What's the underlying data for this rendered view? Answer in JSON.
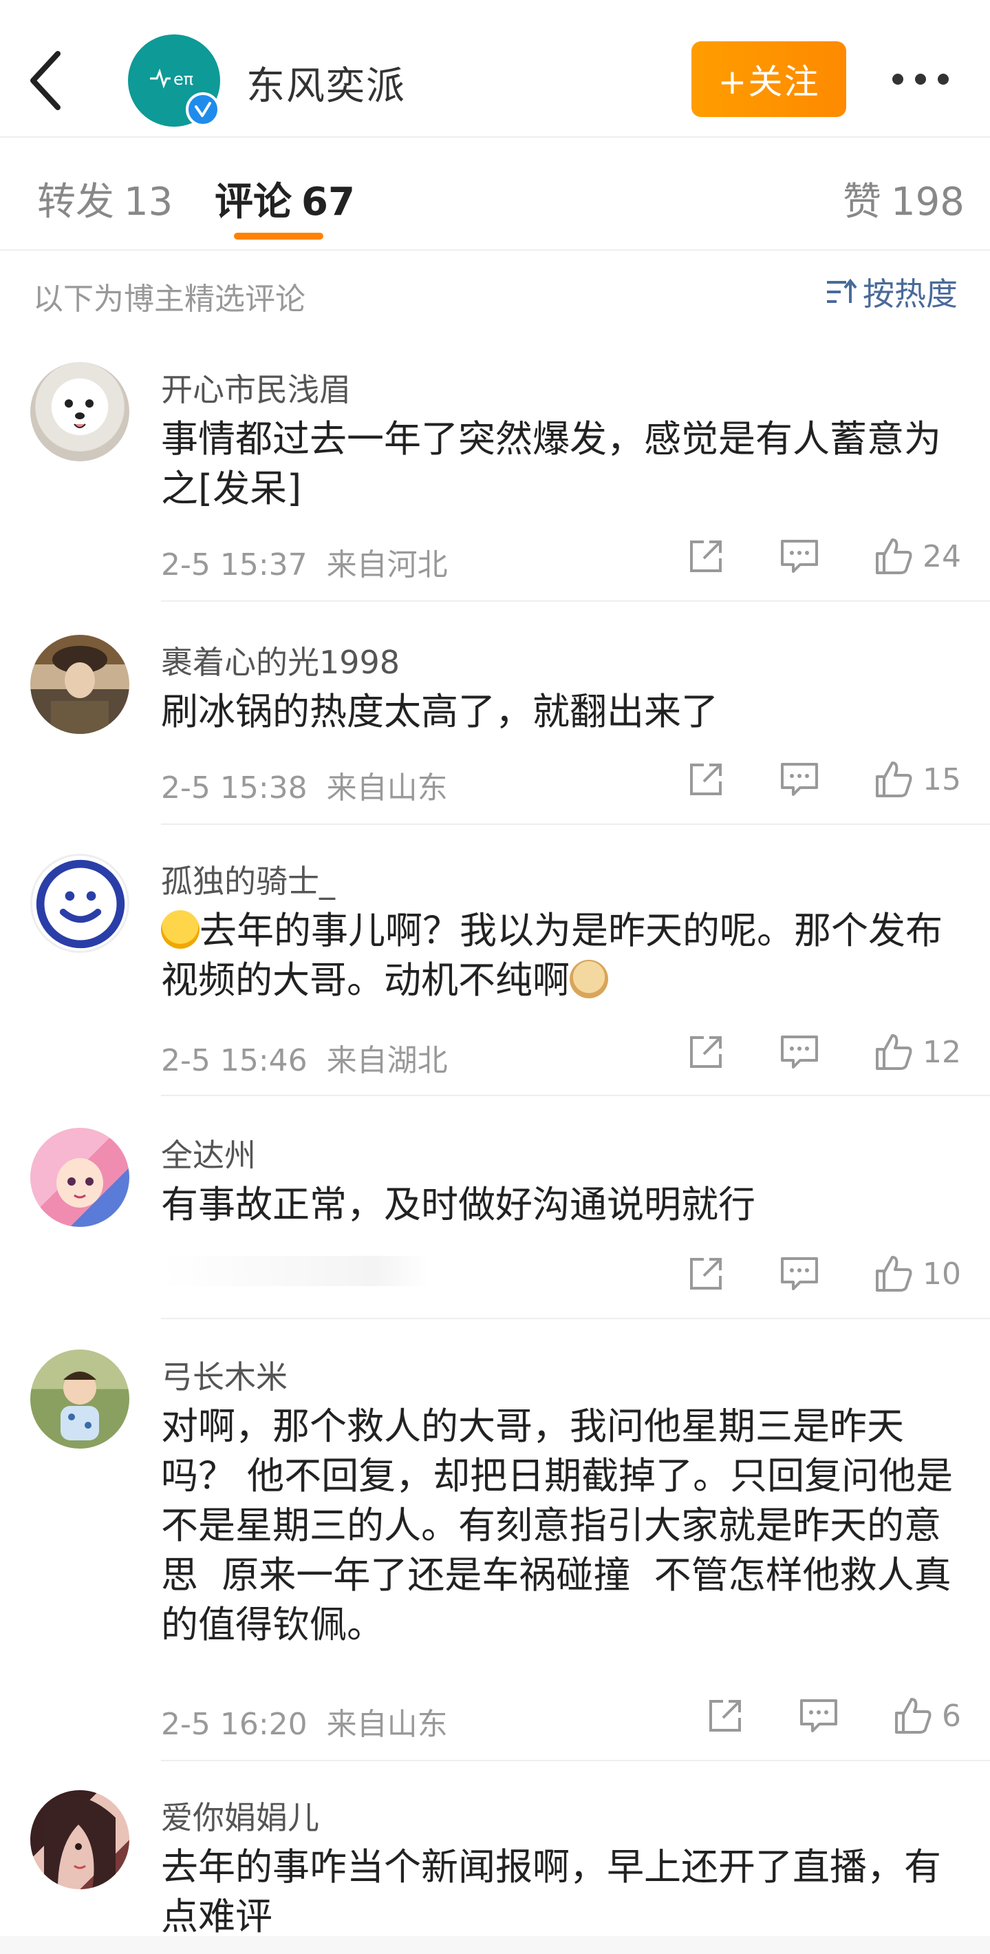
{
  "header": {
    "brand_name": "东风奕派",
    "follow_label": "+关注"
  },
  "tabs": {
    "repost": {
      "label": "转发",
      "count": "13"
    },
    "comment": {
      "label": "评论",
      "count": "67"
    },
    "like": {
      "label": "赞",
      "count": "198"
    }
  },
  "selected": {
    "label": "以下为博主精选评论",
    "sort_label": "按热度"
  },
  "comments": [
    {
      "user": "开心市民浅眉",
      "text": "事情都过去一年了突然爆发，感觉是有人蓄意为之[发呆]",
      "time": "2-5 15:37",
      "location": "来自河北",
      "likes": "24"
    },
    {
      "user": "裹着心的光1998",
      "text": "刷冰锅的热度太高了，就翻出来了",
      "time": "2-5 15:38",
      "location": "来自山东",
      "likes": "15"
    },
    {
      "user": "孤独的骑士_",
      "text_before": "去年的事儿啊？我以为是昨天的呢。那个发布视频的大哥。动机不纯啊",
      "time": "2-5 15:46",
      "location": "来自湖北",
      "likes": "12"
    },
    {
      "user": "全达州",
      "text": "有事故正常，及时做好沟通说明就行",
      "time": "",
      "location": "",
      "likes": "10"
    },
    {
      "user": "弓长木米",
      "text": "对啊，那个救人的大哥，我问他星期三是昨天吗？ 他不回复，却把日期截掉了。只回复问他是不是星期三的人。有刻意指引大家就是昨天的意思  原来一年了还是车祸碰撞  不管怎样他救人真的值得钦佩。",
      "time": "2-5 16:20",
      "location": "来自山东",
      "likes": "6"
    },
    {
      "user": "爱你娟娟儿",
      "text": "去年的事咋当个新闻报啊，早上还开了直播，有点难评",
      "time": "",
      "location": "",
      "likes": ""
    }
  ],
  "colors": {
    "accent": "#ff8200",
    "brand_teal": "#0e9a97",
    "link_blue": "#4a6a9a"
  },
  "icons": [
    "back-arrow-icon",
    "verified-icon",
    "more-dots-icon",
    "sort-icon",
    "share-icon",
    "comment-icon",
    "like-icon"
  ]
}
